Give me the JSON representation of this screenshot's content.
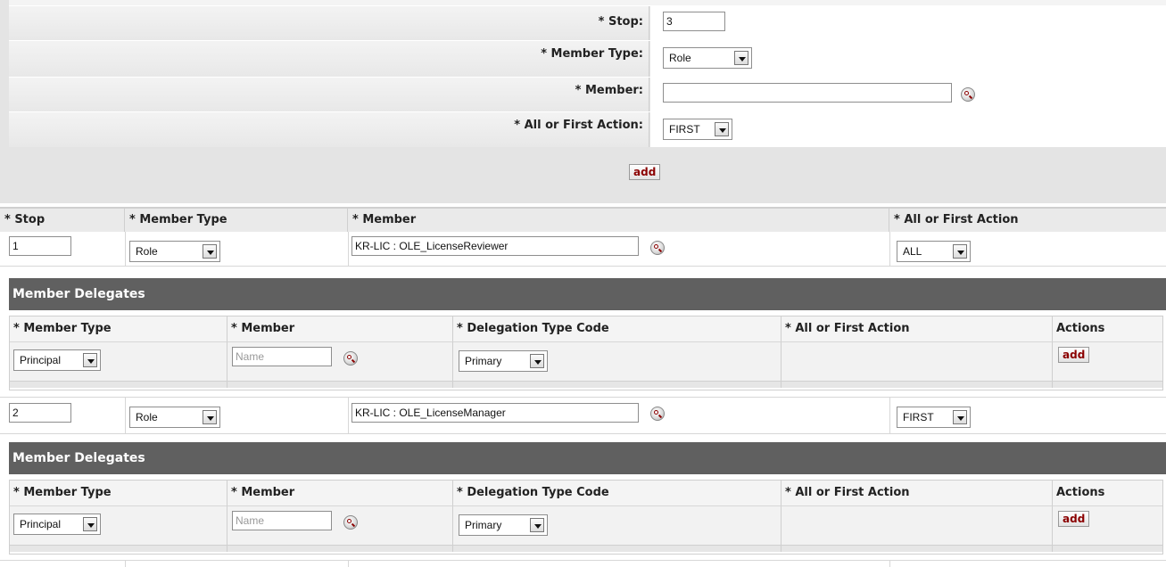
{
  "add_form": {
    "stop_label": "* Stop:",
    "stop_value": "3",
    "member_type_label": "* Member Type:",
    "member_type_value": "Role",
    "member_label": "* Member:",
    "member_value": "",
    "action_label": "* All or First Action:",
    "action_value": "FIRST",
    "add_label": "add"
  },
  "columns": {
    "stop": "* Stop",
    "member_type": "* Member Type",
    "member": "* Member",
    "action": "* All or First Action"
  },
  "rows": [
    {
      "stop": "1",
      "member_type": "Role",
      "member": "KR-LIC : OLE_LicenseReviewer",
      "action": "ALL",
      "delegates": {
        "title": "Member Delegates",
        "headers": [
          "* Member Type",
          "* Member",
          "* Delegation Type Code",
          "* All or First Action",
          "Actions"
        ],
        "member_type": "Principal",
        "member_placeholder": "Name",
        "delegation_type": "Primary",
        "add_label": "add"
      }
    },
    {
      "stop": "2",
      "member_type": "Role",
      "member": "KR-LIC : OLE_LicenseManager",
      "action": "FIRST",
      "delegates": {
        "title": "Member Delegates",
        "headers": [
          "* Member Type",
          "* Member",
          "* Delegation Type Code",
          "* All or First Action",
          "Actions"
        ],
        "member_type": "Principal",
        "member_placeholder": "Name",
        "delegation_type": "Primary",
        "add_label": "add"
      }
    }
  ],
  "icons": {
    "lookup": "magnifier-lookup-icon",
    "dropdown": "chevron-down-icon"
  },
  "colors": {
    "delegate_header_bg": "#606060",
    "add_button_text": "#8b0000",
    "add_area_bg": "#e4e4e4"
  }
}
